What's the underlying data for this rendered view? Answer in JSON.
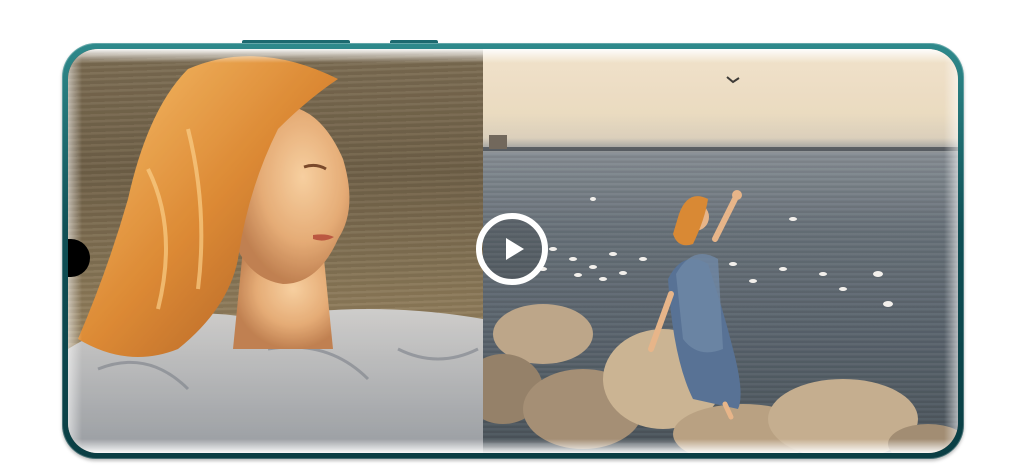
{
  "media": {
    "left_panel": "close-up-portrait",
    "right_panel": "seaside-scene",
    "play_icon": "play-icon"
  },
  "colors": {
    "phone_frame": "#0f4f55",
    "background": "#ffffff",
    "play_button": "#ffffff"
  }
}
